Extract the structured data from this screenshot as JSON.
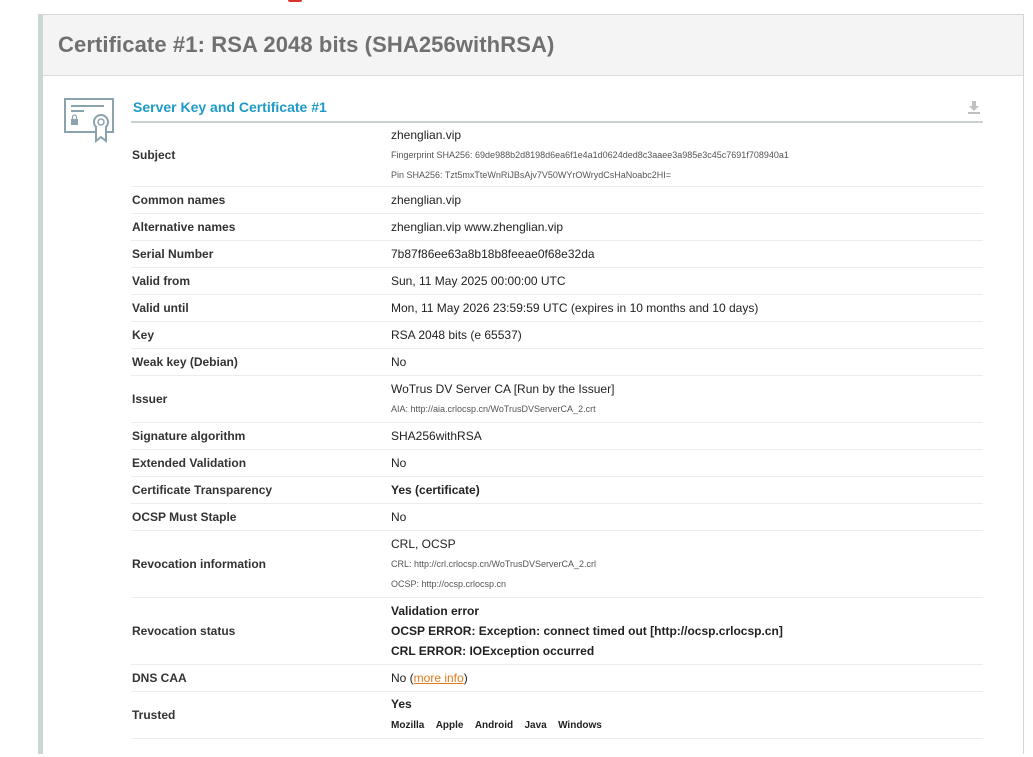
{
  "panel": {
    "title": "Certificate #1: RSA 2048 bits (SHA256withRSA)"
  },
  "section": {
    "title": "Server Key and Certificate #1"
  },
  "rows": {
    "subject": {
      "label": "Subject",
      "value": "zhenglian.vip",
      "fingerprint": "Fingerprint SHA256: 69de988b2d8198d6ea6f1e4a1d0624ded8c3aaee3a985e3c45c7691f708940a1",
      "pin": "Pin SHA256: Tzt5mxTteWnRiJBsAjv7V50WYrOWrydCsHaNoabc2HI="
    },
    "common_names": {
      "label": "Common names",
      "value": "zhenglian.vip"
    },
    "alternative_names": {
      "label": "Alternative names",
      "value": "zhenglian.vip www.zhenglian.vip"
    },
    "serial_number": {
      "label": "Serial Number",
      "value": "7b87f86ee63a8b18b8feeae0f68e32da"
    },
    "valid_from": {
      "label": "Valid from",
      "value": "Sun, 11 May 2025 00:00:00 UTC"
    },
    "valid_until": {
      "label": "Valid until",
      "value": "Mon, 11 May 2026 23:59:59 UTC (expires in 10 months and 10 days)"
    },
    "key": {
      "label": "Key",
      "value": "RSA 2048 bits (e 65537)"
    },
    "weak_key": {
      "label": "Weak key (Debian)",
      "value": "No"
    },
    "issuer": {
      "label": "Issuer",
      "value": "WoTrus DV Server CA [Run by the Issuer]",
      "aia": "AIA: http://aia.crlocsp.cn/WoTrusDVServerCA_2.crt"
    },
    "signature_algorithm": {
      "label": "Signature algorithm",
      "value": "SHA256withRSA"
    },
    "extended_validation": {
      "label": "Extended Validation",
      "value": "No"
    },
    "certificate_transparency": {
      "label": "Certificate Transparency",
      "value": "Yes (certificate)"
    },
    "ocsp_must_staple": {
      "label": "OCSP Must Staple",
      "value": "No"
    },
    "revocation_information": {
      "label": "Revocation information",
      "value": "CRL, OCSP",
      "crl": "CRL: http://crl.crlocsp.cn/WoTrusDVServerCA_2.crl",
      "ocsp": "OCSP: http://ocsp.crlocsp.cn"
    },
    "revocation_status": {
      "label": "Revocation status",
      "line1": "Validation error",
      "line2": "OCSP ERROR: Exception: connect timed out [http://ocsp.crlocsp.cn]",
      "line3": "CRL ERROR: IOException occurred"
    },
    "dns_caa": {
      "label": "DNS CAA",
      "value_prefix": "No (",
      "link": "more info",
      "value_suffix": ")"
    },
    "trusted": {
      "label": "Trusted",
      "value": "Yes",
      "stores": [
        "Mozilla",
        "Apple",
        "Android",
        "Java",
        "Windows"
      ]
    }
  },
  "colors": {
    "title_gray": "#707070",
    "section_blue": "#1d9bc6",
    "good_green": "#138a0c",
    "warn_orange": "#e07b19"
  },
  "icons": {
    "certificate": "certificate-icon",
    "download": "download-icon"
  }
}
